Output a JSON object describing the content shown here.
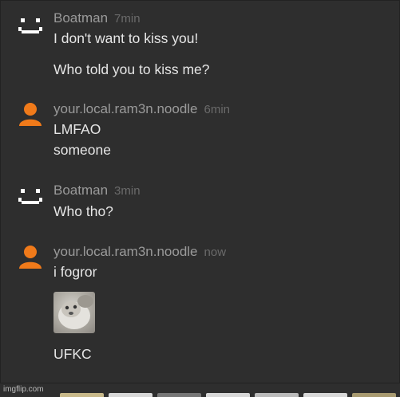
{
  "messages": [
    {
      "user": "Boatman",
      "time": "7min",
      "avatar": "robot-face-icon",
      "lines": [
        "I don't want to kiss you!",
        "Who told you to kiss me?"
      ]
    },
    {
      "user": "your.local.ram3n.noodle",
      "time": "6min",
      "avatar": "person-icon",
      "lines": [
        "LMFAO",
        "someone"
      ]
    },
    {
      "user": "Boatman",
      "time": "3min",
      "avatar": "robot-face-icon",
      "lines": [
        "Who tho?"
      ]
    },
    {
      "user": "your.local.ram3n.noodle",
      "time": "now",
      "avatar": "person-icon",
      "lines": [
        "i fogror"
      ],
      "attachment": "seal-photo-thumbnail",
      "after": "UFKC"
    }
  ],
  "watermark": "imgflip.com",
  "colors": {
    "background": "#2e2e2e",
    "username": "#9a9a9a",
    "timestamp": "#6a6a6a",
    "text": "#e6e6e6",
    "person_avatar": "#f07a1a",
    "robot_avatar": "#ffffff"
  }
}
